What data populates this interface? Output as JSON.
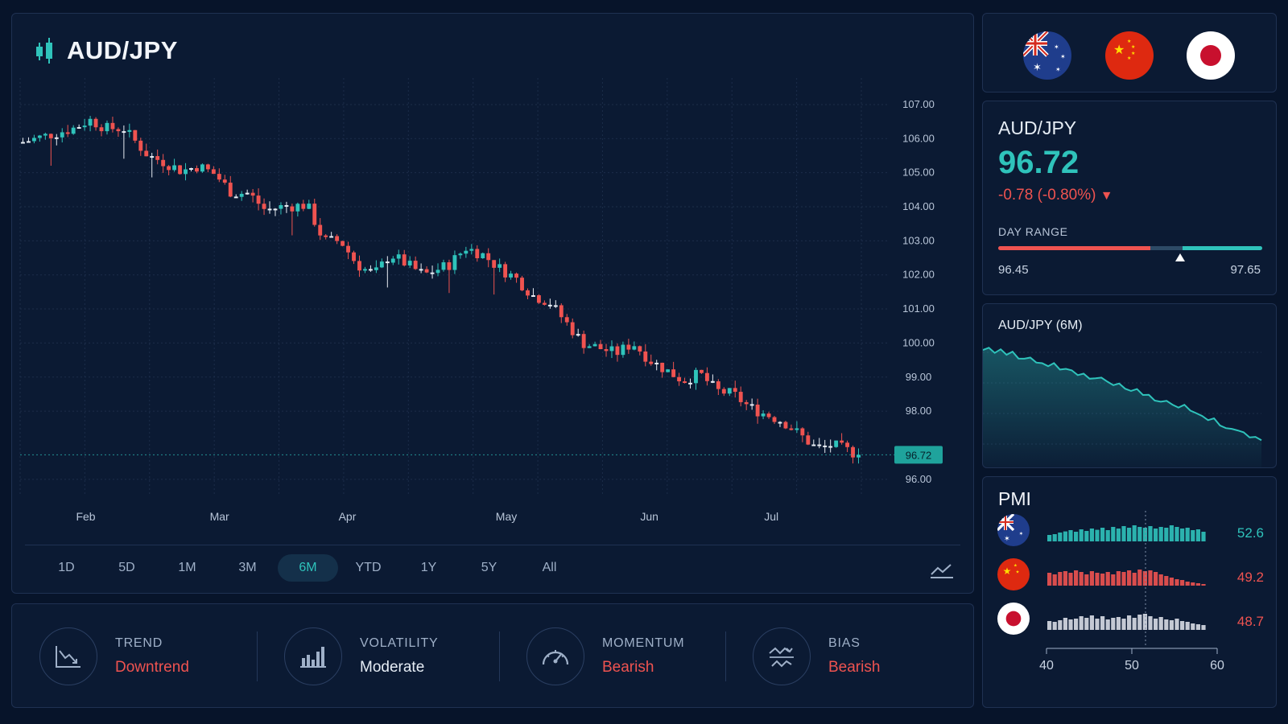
{
  "main": {
    "pair": "AUD/JPY",
    "y_axis": [
      "107.00",
      "106.00",
      "105.00",
      "104.00",
      "103.00",
      "102.00",
      "101.00",
      "100.00",
      "99.00",
      "98.00",
      "96.00"
    ],
    "x_axis": [
      "Feb",
      "Mar",
      "Apr",
      "May",
      "Jun",
      "Jul"
    ],
    "current_price_tag": "96.72",
    "timeframes": [
      "1D",
      "5D",
      "1M",
      "3M",
      "6M",
      "YTD",
      "1Y",
      "5Y",
      "All"
    ],
    "active_timeframe": "6M",
    "colors": {
      "up": "#2fc3bb",
      "down": "#ef5350",
      "doji": "#e8edf4"
    }
  },
  "chart_data": {
    "type": "line",
    "title": "AUD/JPY",
    "x_ticks": [
      "Feb",
      "Mar",
      "Apr",
      "May",
      "Jun",
      "Jul"
    ],
    "y_ticks": [
      107,
      106,
      105,
      104,
      103,
      102,
      101,
      100,
      99,
      98,
      96
    ],
    "ylim": [
      95.5,
      107.4
    ],
    "last": 96.72,
    "close_path": [
      {
        "x": 0.0,
        "y": 105.9
      },
      {
        "x": 0.03,
        "y": 106.1
      },
      {
        "x": 0.06,
        "y": 106.3
      },
      {
        "x": 0.08,
        "y": 106.55
      },
      {
        "x": 0.1,
        "y": 106.3
      },
      {
        "x": 0.12,
        "y": 106.3
      },
      {
        "x": 0.15,
        "y": 105.5
      },
      {
        "x": 0.17,
        "y": 105.3
      },
      {
        "x": 0.19,
        "y": 105.05
      },
      {
        "x": 0.21,
        "y": 105.2
      },
      {
        "x": 0.23,
        "y": 104.95
      },
      {
        "x": 0.25,
        "y": 104.4
      },
      {
        "x": 0.27,
        "y": 104.4
      },
      {
        "x": 0.29,
        "y": 103.9
      },
      {
        "x": 0.31,
        "y": 104.0
      },
      {
        "x": 0.34,
        "y": 104.05
      },
      {
        "x": 0.36,
        "y": 103.0
      },
      {
        "x": 0.38,
        "y": 103.0
      },
      {
        "x": 0.4,
        "y": 102.3
      },
      {
        "x": 0.42,
        "y": 102.0
      },
      {
        "x": 0.44,
        "y": 102.6
      },
      {
        "x": 0.46,
        "y": 102.3
      },
      {
        "x": 0.48,
        "y": 102.0
      },
      {
        "x": 0.51,
        "y": 102.3
      },
      {
        "x": 0.53,
        "y": 102.8
      },
      {
        "x": 0.55,
        "y": 102.6
      },
      {
        "x": 0.57,
        "y": 102.2
      },
      {
        "x": 0.59,
        "y": 101.9
      },
      {
        "x": 0.61,
        "y": 101.4
      },
      {
        "x": 0.63,
        "y": 101.2
      },
      {
        "x": 0.65,
        "y": 100.6
      },
      {
        "x": 0.67,
        "y": 100.0
      },
      {
        "x": 0.69,
        "y": 99.85
      },
      {
        "x": 0.71,
        "y": 99.7
      },
      {
        "x": 0.73,
        "y": 100.0
      },
      {
        "x": 0.75,
        "y": 99.5
      },
      {
        "x": 0.77,
        "y": 99.2
      },
      {
        "x": 0.79,
        "y": 98.9
      },
      {
        "x": 0.81,
        "y": 99.1
      },
      {
        "x": 0.83,
        "y": 98.6
      },
      {
        "x": 0.85,
        "y": 98.5
      },
      {
        "x": 0.87,
        "y": 98.1
      },
      {
        "x": 0.89,
        "y": 97.9
      },
      {
        "x": 0.91,
        "y": 97.7
      },
      {
        "x": 0.93,
        "y": 97.3
      },
      {
        "x": 0.95,
        "y": 96.9
      },
      {
        "x": 0.97,
        "y": 97.0
      },
      {
        "x": 1.0,
        "y": 96.72
      }
    ]
  },
  "indicators": [
    {
      "label": "TREND",
      "value": "Downtrend",
      "tone": "red",
      "icon": "downtrend-chart-icon"
    },
    {
      "label": "VOLATILITY",
      "value": "Moderate",
      "tone": "white",
      "icon": "bar-chart-icon"
    },
    {
      "label": "MOMENTUM",
      "value": "Bearish",
      "tone": "red",
      "icon": "speedometer-icon"
    },
    {
      "label": "BIAS",
      "value": "Bearish",
      "tone": "red",
      "icon": "bias-waves-icon"
    }
  ],
  "flags": [
    "australia-flag-icon",
    "china-flag-icon",
    "japan-flag-icon"
  ],
  "quote": {
    "pair": "AUD/JPY",
    "price": "96.72",
    "change": "-0.78 (-0.80%)",
    "change_arrow": "▼",
    "range_label": "DAY RANGE",
    "low": "96.45",
    "high": "97.65",
    "current_fraction": 0.69
  },
  "mini_chart": {
    "title": "AUD/JPY (6M)",
    "color": "#2fc3bb",
    "values": [
      106.3,
      106.5,
      106.2,
      106.4,
      105.9,
      106.1,
      105.6,
      105.4,
      105.5,
      105.0,
      105.1,
      104.7,
      104.9,
      104.3,
      104.4,
      104.0,
      103.8,
      103.9,
      103.4,
      103.2,
      103.3,
      102.9,
      102.7,
      102.8,
      102.3,
      101.9,
      102.1,
      101.6,
      101.4,
      101.0,
      100.8,
      100.9,
      100.4,
      100.2,
      100.3,
      99.8,
      99.5,
      99.1,
      98.8,
      98.9,
      98.4,
      98.1,
      97.9,
      97.6,
      97.4,
      97.1,
      96.9,
      96.72
    ]
  },
  "pmi": {
    "title": "PMI",
    "axis": [
      "40",
      "50",
      "60"
    ],
    "rows": [
      {
        "country": "australia",
        "value": "52.6",
        "color": "#2fc3bb",
        "bars": [
          0.4,
          0.45,
          0.55,
          0.62,
          0.7,
          0.6,
          0.75,
          0.65,
          0.8,
          0.72,
          0.85,
          0.7,
          0.9,
          0.8,
          0.95,
          0.85,
          1.0,
          0.9,
          0.85,
          0.95,
          0.8,
          0.9,
          0.85,
          1.0,
          0.9,
          0.8,
          0.85,
          0.7,
          0.75,
          0.6
        ]
      },
      {
        "country": "china",
        "value": "49.2",
        "color": "#ef5350",
        "bars": [
          0.8,
          0.7,
          0.85,
          0.9,
          0.8,
          0.95,
          0.85,
          0.7,
          0.9,
          0.8,
          0.75,
          0.85,
          0.7,
          0.9,
          0.85,
          0.95,
          0.8,
          1.0,
          0.9,
          0.95,
          0.85,
          0.7,
          0.6,
          0.5,
          0.4,
          0.35,
          0.25,
          0.2,
          0.15,
          0.1
        ]
      },
      {
        "country": "japan",
        "value": "48.7",
        "color": "#d8dde6",
        "bars": [
          0.55,
          0.5,
          0.6,
          0.75,
          0.65,
          0.7,
          0.85,
          0.75,
          0.9,
          0.7,
          0.85,
          0.65,
          0.75,
          0.8,
          0.7,
          0.9,
          0.75,
          0.95,
          1.0,
          0.85,
          0.7,
          0.8,
          0.65,
          0.6,
          0.7,
          0.55,
          0.5,
          0.4,
          0.35,
          0.3
        ]
      }
    ]
  }
}
